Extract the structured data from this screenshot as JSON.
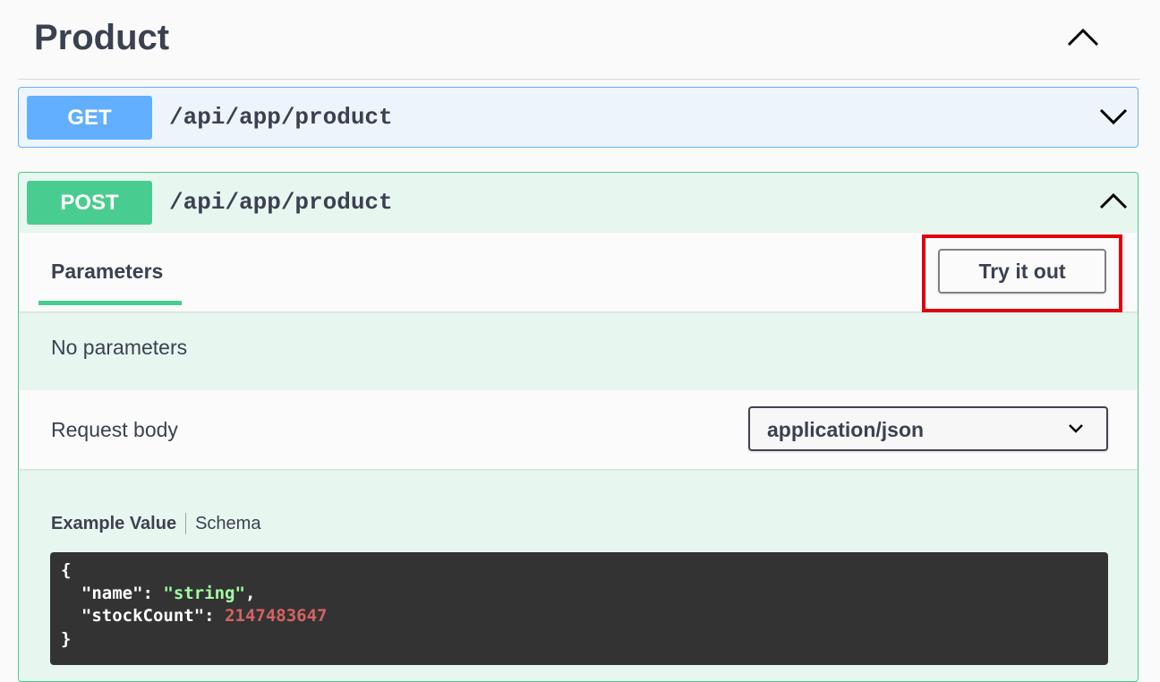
{
  "tag": {
    "title": "Product",
    "toggle_icon": "chevron-up-icon"
  },
  "operations": [
    {
      "method": "GET",
      "path": "/api/app/product",
      "color": "#61affe",
      "expanded": false
    },
    {
      "method": "POST",
      "path": "/api/app/product",
      "color": "#49cc90",
      "expanded": true
    }
  ],
  "post_details": {
    "parameters_tab": "Parameters",
    "try_it_out": "Try it out",
    "no_parameters": "No parameters",
    "request_body_label": "Request body",
    "content_type": "application/json",
    "example_tabs": {
      "example_value": "Example Value",
      "schema": "Schema"
    },
    "example_code": {
      "open_brace": "{",
      "name_key": "\"name\"",
      "name_value": "\"string\"",
      "stock_key": "\"stockCount\"",
      "stock_value": "2147483647",
      "close_brace": "}"
    }
  },
  "colors": {
    "highlight": "#e0000b",
    "post_accent": "#49cc90",
    "get_accent": "#61affe"
  }
}
